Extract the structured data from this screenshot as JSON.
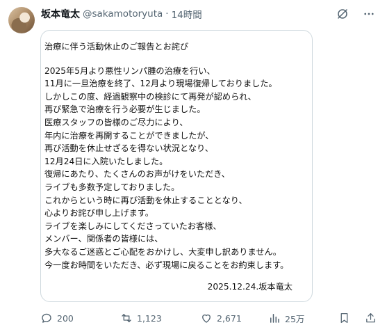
{
  "author": {
    "display_name": "坂本竜太",
    "handle": "@sakamotoryuta",
    "separator": "·",
    "time": "14時間"
  },
  "icons": {
    "grok": "grok-icon",
    "more": "more-icon",
    "reply": "reply-icon",
    "repost": "repost-icon",
    "like": "like-icon",
    "views": "views-icon",
    "bookmark": "bookmark-icon",
    "share": "share-icon"
  },
  "statement": {
    "title": "治療に伴う活動休止のご報告とお詫び",
    "lines": [
      "2025年5月より悪性リンパ腫の治療を行い、",
      "11月に一旦治療を終了、12月より現場復帰しておりました。",
      "しかしこの度、経過観察中の検診にて再発が認められ、",
      "再び緊急で治療を行う必要が生じました。",
      "医療スタッフの皆様のご尽力により、",
      "年内に治療を再開することができましたが、",
      "再び活動を休止せざるを得ない状況となり、",
      "12月24日に入院いたしました。",
      "復帰にあたり、たくさんのお声がけをいただき、",
      "ライブも多数予定しておりました。",
      "これからという時に再び活動を休止することとなり、",
      "心よりお詫び申し上げます。",
      "ライブを楽しみにしてくださっていたお客様、",
      "メンバー、関係者の皆様には、",
      "多大なるご迷惑とご心配をおかけし、大変申し訳ありません。",
      "今一度お時間をいただき、必ず現場に戻ることをお約束します。"
    ],
    "signature": "2025.12.24.坂本竜太"
  },
  "stats": {
    "replies": "200",
    "reposts": "1,123",
    "likes": "2,671",
    "views": "25万"
  },
  "colors": {
    "text": "#0f1419",
    "secondary": "#536471",
    "border": "#cfd9de"
  }
}
